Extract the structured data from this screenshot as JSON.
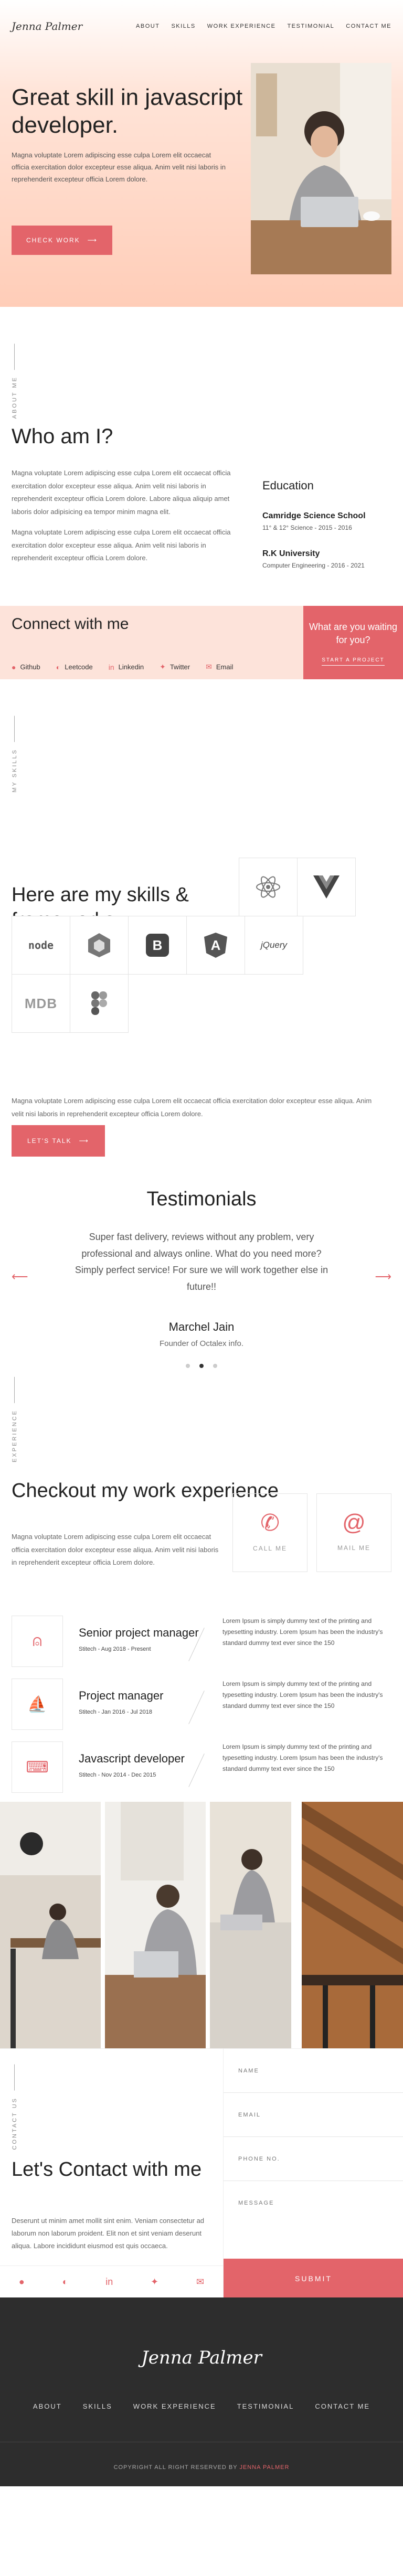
{
  "nav": {
    "logo": "Jenna Palmer",
    "links": [
      "ABOUT",
      "SKILLS",
      "WORK EXPERIENCE",
      "TESTIMONIAL",
      "CONTACT ME"
    ]
  },
  "hero": {
    "title": "Great skill in javascript developer.",
    "text": "Magna voluptate Lorem adipiscing esse culpa Lorem elit occaecat officia exercitation dolor excepteur esse aliqua. Anim velit nisi laboris in reprehenderit excepteur officia Lorem dolore.",
    "button": "CHECK WORK"
  },
  "about": {
    "label": "ABOUT ME",
    "title": "Who am I?",
    "p1": "Magna voluptate Lorem adipiscing esse culpa Lorem elit occaecat officia exercitation dolor excepteur esse aliqua. Anim velit nisi laboris in reprehenderit excepteur officia Lorem dolore. Labore aliqua aliquip amet laboris dolor adipisicing ea tempor minim magna elit.",
    "p2": "Magna voluptate Lorem adipiscing esse culpa Lorem elit occaecat officia exercitation dolor excepteur esse aliqua. Anim velit nisi laboris in reprehenderit excepteur officia Lorem dolore.",
    "education_title": "Education",
    "education": [
      {
        "school": "Camridge Science School",
        "detail": "11° & 12° Science - 2015 - 2016"
      },
      {
        "school": "R.K University",
        "detail": "Computer Engineering - 2016 - 2021"
      }
    ]
  },
  "connect": {
    "title": "Connect with me",
    "socials": [
      "Github",
      "Leetcode",
      "Linkedin",
      "Twitter",
      "Email"
    ],
    "waiting_text": "What are you waiting for you?",
    "waiting_cta": "START A PROJECT"
  },
  "skills": {
    "label": "MY SKILLS",
    "title": "Here are my skills & frameworks.",
    "tiles": [
      "React",
      "Vue",
      "node",
      "Webpack",
      "Bootstrap",
      "Angular",
      "jQuery",
      "MDB",
      "Figma"
    ],
    "text": "Magna voluptate Lorem adipiscing esse culpa Lorem elit occaecat officia exercitation dolor excepteur esse aliqua. Anim velit nisi laboris in reprehenderit excepteur officia Lorem dolore.",
    "button": "LET'S TALK"
  },
  "testimonials": {
    "title": "Testimonials",
    "quote": "Super fast delivery, reviews without any problem, very professional and always online. What do you need more? Simply perfect service! For sure we will work together else in future!!",
    "name": "Marchel Jain",
    "role": "Founder of Octalex info."
  },
  "experience": {
    "label": "EXPERIENCE",
    "title": "Checkout my work experience",
    "text": "Magna voluptate Lorem adipiscing esse culpa Lorem elit occaecat officia exercitation dolor excepteur esse aliqua. Anim velit nisi laboris in reprehenderit excepteur officia Lorem dolore.",
    "call": "CALL ME",
    "mail": "MAIL ME",
    "jobs": [
      {
        "title": "Senior project manager",
        "meta": "Stitech - Aug 2018 - Present",
        "desc": "Lorem Ipsum is simply dummy text of the printing and typesetting industry. Lorem Ipsum has been the industry's standard dummy text ever since the 150"
      },
      {
        "title": "Project manager",
        "meta": "Stitech - Jan 2016 - Jul 2018",
        "desc": "Lorem Ipsum is simply dummy text of the printing and typesetting industry. Lorem Ipsum has been the industry's standard dummy text ever since the 150"
      },
      {
        "title": "Javascript developer",
        "meta": "Stitech - Nov 2014 - Dec 2015",
        "desc": "Lorem Ipsum is simply dummy text of the printing and typesetting industry. Lorem Ipsum has been the industry's standard dummy text ever since the 150"
      }
    ]
  },
  "contact": {
    "label": "CONTACT US",
    "title": "Let's Contact with me",
    "text": "Deserunt ut minim amet mollit sint enim. Veniam consectetur ad laborum non laborum proident. Elit non et sint veniam deserunt aliqua. Labore incididunt eiusmod est quis occaeca.",
    "fields": [
      "NAME",
      "EMAIL",
      "PHONE NO.",
      "MESSAGE"
    ],
    "submit": "SUBMIT"
  },
  "footer": {
    "logo": "Jenna Palmer",
    "links": [
      "ABOUT",
      "SKILLS",
      "WORK EXPERIENCE",
      "TESTIMONIAL",
      "CONTACT ME"
    ],
    "copyright": "COPYRIGHT ALL RIGHT RESERVED BY",
    "copyright_name": "JENNA PALMER"
  },
  "colors": {
    "accent": "#e3646a",
    "hero_bg": "#ffcdb8",
    "connect_bg": "#fde3da",
    "footer_bg": "#2d2d2d"
  }
}
